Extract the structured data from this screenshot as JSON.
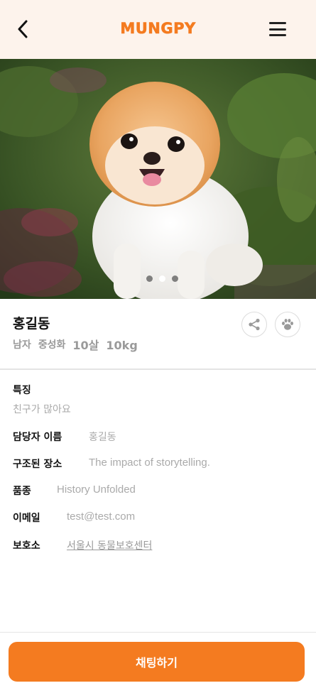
{
  "header": {
    "logo": "MUNGPY"
  },
  "carousel": {
    "slides": 3,
    "active_slide": 2
  },
  "pet": {
    "name": "홍길동",
    "gender": "남자",
    "neutered": "중성화",
    "age": "10살",
    "weight": "10kg"
  },
  "details": {
    "features_label": "특징",
    "features_value": "친구가 많아요",
    "manager_label": "담당자 이름",
    "manager_value": "홍길동",
    "rescue_label": "구조된 장소",
    "rescue_value": "The impact of storytelling.",
    "breed_label": "품종",
    "breed_value": "History Unfolded",
    "email_label": "이메일",
    "email_value": "test@test.com",
    "shelter_label": "보호소",
    "shelter_value": "서울시 동물보호센터"
  },
  "actions": {
    "chat_label": "채팅하기"
  },
  "colors": {
    "accent": "#f47b20",
    "header_bg": "#fdf3ec"
  },
  "icons": [
    "back-arrow-icon",
    "hamburger-menu-icon",
    "share-icon",
    "paw-icon"
  ]
}
